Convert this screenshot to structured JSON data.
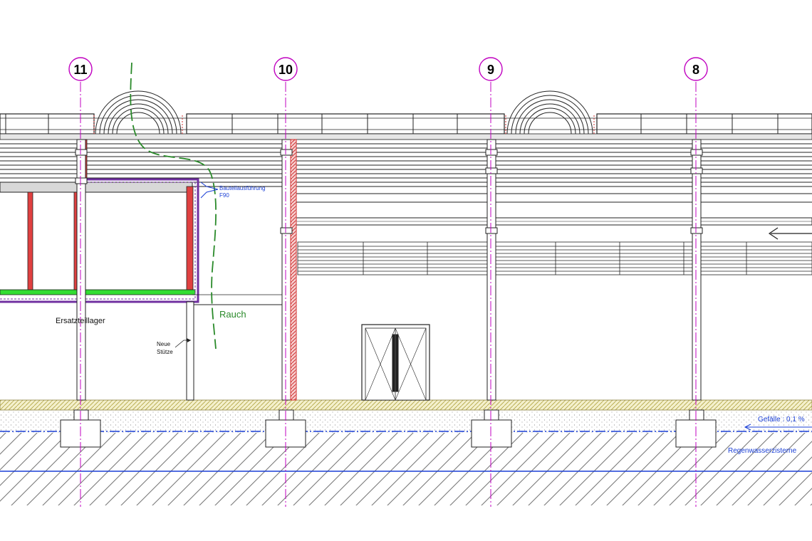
{
  "axes": [
    {
      "id": "axis-11",
      "label": "11"
    },
    {
      "id": "axis-10",
      "label": "10"
    },
    {
      "id": "axis-9",
      "label": "9"
    },
    {
      "id": "axis-8",
      "label": "8"
    }
  ],
  "annotations": {
    "room_label": "Ersatzteillager",
    "fire_rating_line1": "Bauteilausführung",
    "fire_rating_line2": "F90",
    "new_column_line1": "Neue",
    "new_column_line2": "Stütze",
    "smoke_label": "Rauch",
    "slope_label": "Gefälle : 0,1 %",
    "cistern_label": "Regenwasserzisterne"
  },
  "colors": {
    "axis_line": "#c000c0",
    "axis_label": "#000000",
    "fire_wall": "#e04040",
    "fire_outline": "#7030a0",
    "annotation_blue": "#1a3fd6",
    "smoke_green": "#2a8a2a",
    "floor_green": "#33dd33",
    "ground_hatch": "#777777",
    "slab_yellow": "#d8d080",
    "structure": "#222222"
  }
}
